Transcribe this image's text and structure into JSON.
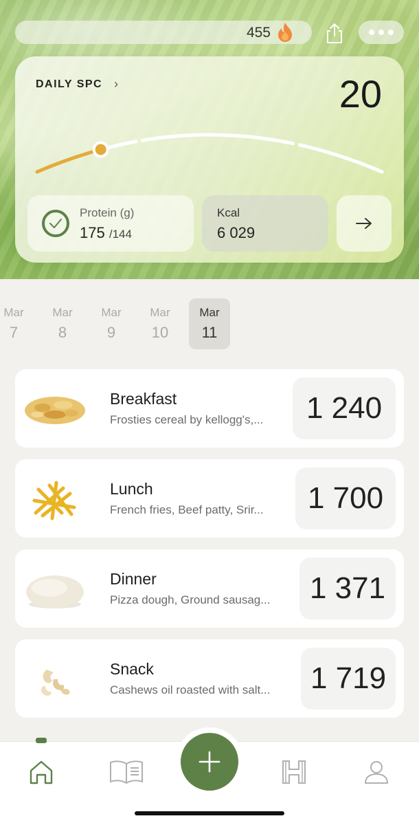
{
  "header": {
    "streak_count": "455",
    "icons": {
      "streak": "flame-icon",
      "share": "share-icon",
      "more": "more-icon"
    }
  },
  "spc_card": {
    "title": "DAILY SPC",
    "value": "20",
    "progress_fraction": 0.19,
    "protein": {
      "label": "Protein (g)",
      "value": "175",
      "target": "/144",
      "icon": "check-circle-icon"
    },
    "kcal": {
      "label": "Kcal",
      "value": "6 029"
    },
    "arrow_icon": "arrow-right-icon"
  },
  "dates": [
    {
      "month": "Mar",
      "day": "7"
    },
    {
      "month": "Mar",
      "day": "8"
    },
    {
      "month": "Mar",
      "day": "9"
    },
    {
      "month": "Mar",
      "day": "10"
    },
    {
      "month": "Mar",
      "day": "11",
      "selected": true
    }
  ],
  "meals": [
    {
      "name": "Breakfast",
      "description": "Frosties cereal by kellogg's,...",
      "kcal": "1 240"
    },
    {
      "name": "Lunch",
      "description": "French fries, Beef patty, Srir...",
      "kcal": "1 700"
    },
    {
      "name": "Dinner",
      "description": "Pizza dough, Ground sausag...",
      "kcal": "1 371"
    },
    {
      "name": "Snack",
      "description": "Cashews oil roasted with salt...",
      "kcal": "1 719"
    }
  ],
  "nav": {
    "items": [
      "home-icon",
      "book-icon",
      "add-icon",
      "hotel-icon",
      "profile-icon"
    ],
    "accent": "#5e8148"
  }
}
